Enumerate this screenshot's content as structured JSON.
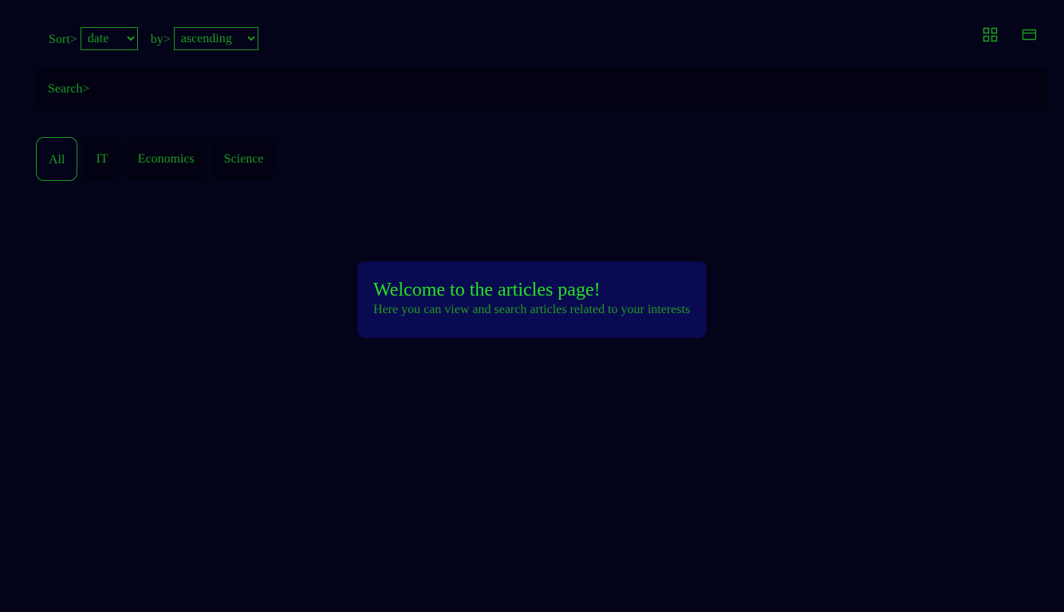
{
  "sort": {
    "label": "Sort>",
    "selected_field": "date",
    "by_label": "by>",
    "selected_order": "ascending"
  },
  "view_toggles": {
    "grid_icon": "grid-view-icon",
    "list_icon": "card-view-icon"
  },
  "search": {
    "label": "Search>",
    "value": ""
  },
  "tabs": [
    {
      "label": "All",
      "active": true
    },
    {
      "label": "IT",
      "active": false
    },
    {
      "label": "Economics",
      "active": false
    },
    {
      "label": "Science",
      "active": false
    }
  ],
  "welcome": {
    "title": "Welcome to the articles page!",
    "subtitle": "Here you can view and search articles related to your interests"
  },
  "colors": {
    "background": "#03031a",
    "accent_green": "#1f9a1f",
    "bright_green": "#22e222",
    "card_bg": "#0a0a52"
  }
}
